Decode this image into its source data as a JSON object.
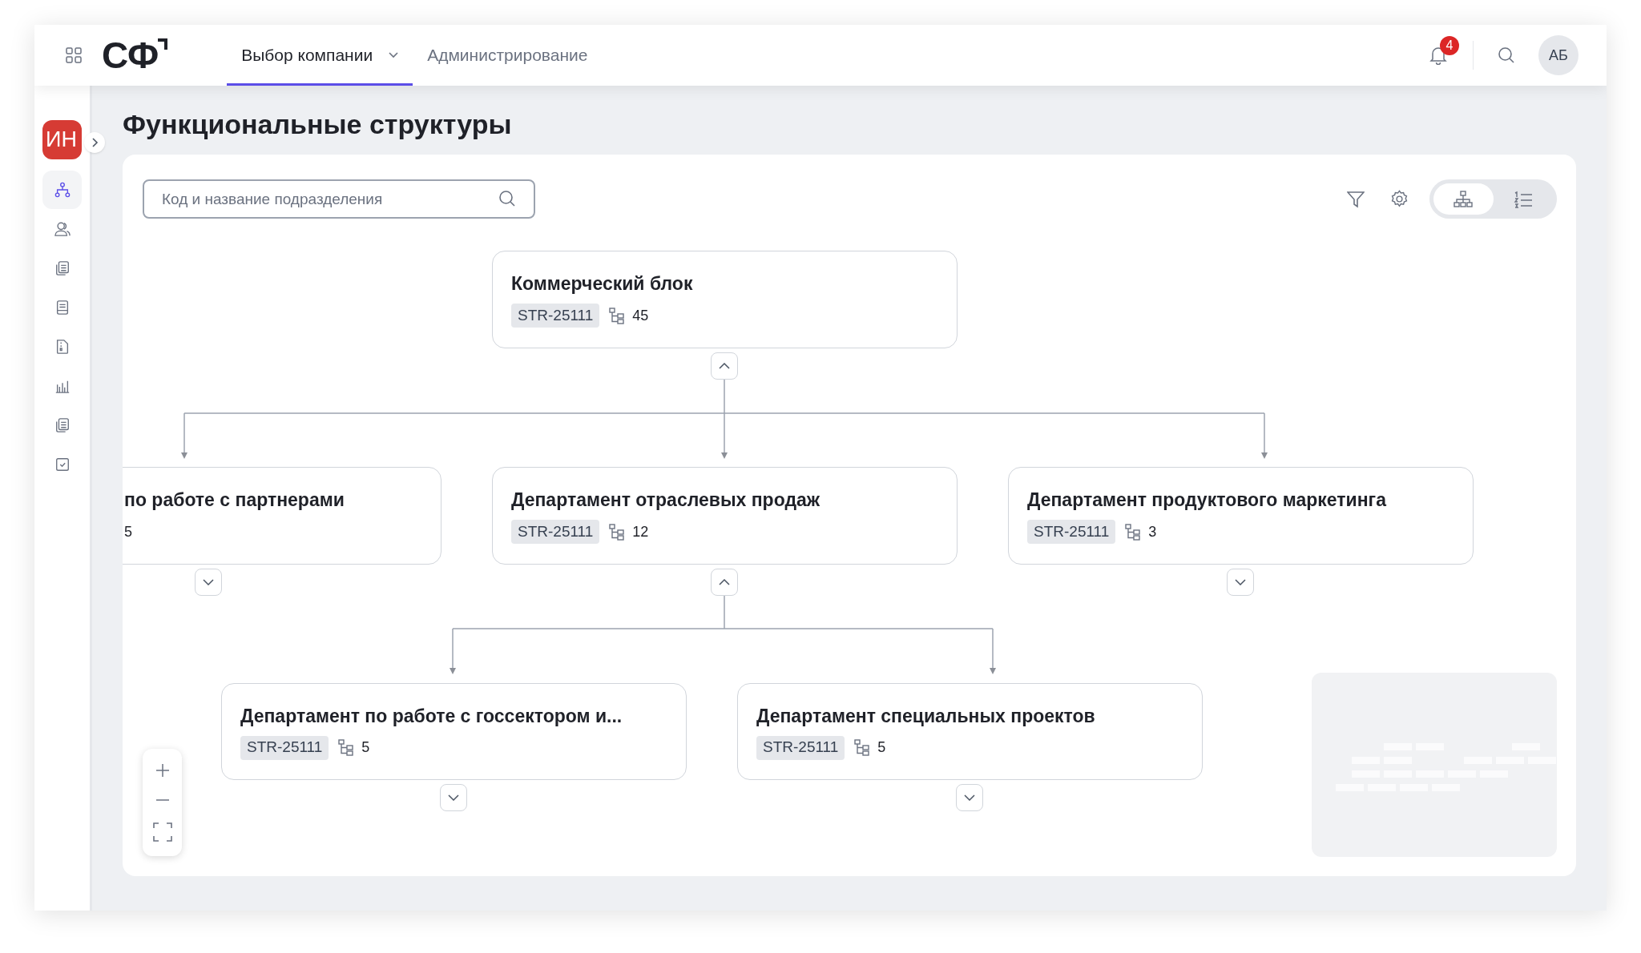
{
  "header": {
    "logo": "СФ",
    "tabs": [
      {
        "label": "Выбор компании",
        "selected": true,
        "dropdown": true
      },
      {
        "label": "Администрирование",
        "selected": false,
        "dropdown": false
      }
    ],
    "notifications": "4",
    "avatar": "АБ"
  },
  "sidebar": {
    "company": "ИН",
    "items": [
      {
        "kind": "structure",
        "selected": true
      },
      {
        "kind": "people",
        "selected": false
      },
      {
        "kind": "documents",
        "selected": false
      },
      {
        "kind": "book",
        "selected": false
      },
      {
        "kind": "file",
        "selected": false
      },
      {
        "kind": "chart",
        "selected": false
      },
      {
        "kind": "documents",
        "selected": false
      },
      {
        "kind": "checklist",
        "selected": false
      }
    ]
  },
  "page": {
    "title": "Функциональные структуры"
  },
  "search": {
    "placeholder": "Код и название подразделения"
  },
  "view_switch": [
    {
      "kind": "tree",
      "selected": true
    },
    {
      "kind": "list",
      "selected": false
    }
  ],
  "nodes": [
    {
      "title": "Коммерческий блок",
      "tag": "STR-25111",
      "count": "45",
      "expanded": true
    },
    {
      "title": "по работе с партнерами",
      "count": "5",
      "expanded": false
    },
    {
      "title": "Департамент отраслевых продаж",
      "tag": "STR-25111",
      "count": "12",
      "expanded": true
    },
    {
      "title": "Департамент продуктового маркетинга",
      "tag": "STR-25111",
      "count": "3",
      "expanded": false
    },
    {
      "title": "Департамент по работе с госсектором и...",
      "tag": "STR-25111",
      "count": "5",
      "expanded": false
    },
    {
      "title": "Департамент специальных проектов",
      "tag": "STR-25111",
      "count": "5",
      "expanded": false
    }
  ]
}
